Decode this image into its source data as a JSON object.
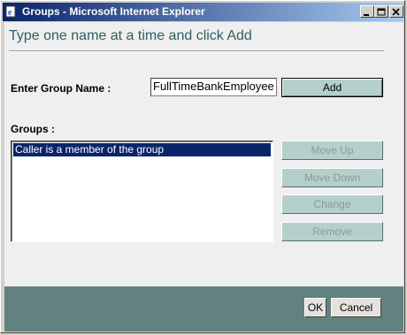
{
  "window": {
    "title": "Groups - Microsoft Internet Explorer",
    "minimize_label": "_",
    "maximize_label": "□",
    "close_label": "×"
  },
  "header": {
    "instruction": "Type one name at a time and click Add"
  },
  "form": {
    "group_name_label": "Enter Group Name :",
    "group_name_value": "FullTimeBankEmployee",
    "add_label": "Add"
  },
  "groups": {
    "label": "Groups :",
    "items": [
      "Caller is a member of the group"
    ],
    "selected_index": 0
  },
  "actions": {
    "move_up": "Move Up",
    "move_down": "Move Down",
    "change": "Change",
    "remove": "Remove"
  },
  "footer": {
    "ok_label": "OK",
    "cancel_label": "Cancel"
  },
  "colors": {
    "title_bar": "#0a246a",
    "heading_text": "#2f5f5f",
    "button_teal": "#b4cfcc",
    "footer_bg": "#628281",
    "selection": "#0a246a"
  },
  "icons": {
    "title_icon": "ie-page-icon"
  }
}
